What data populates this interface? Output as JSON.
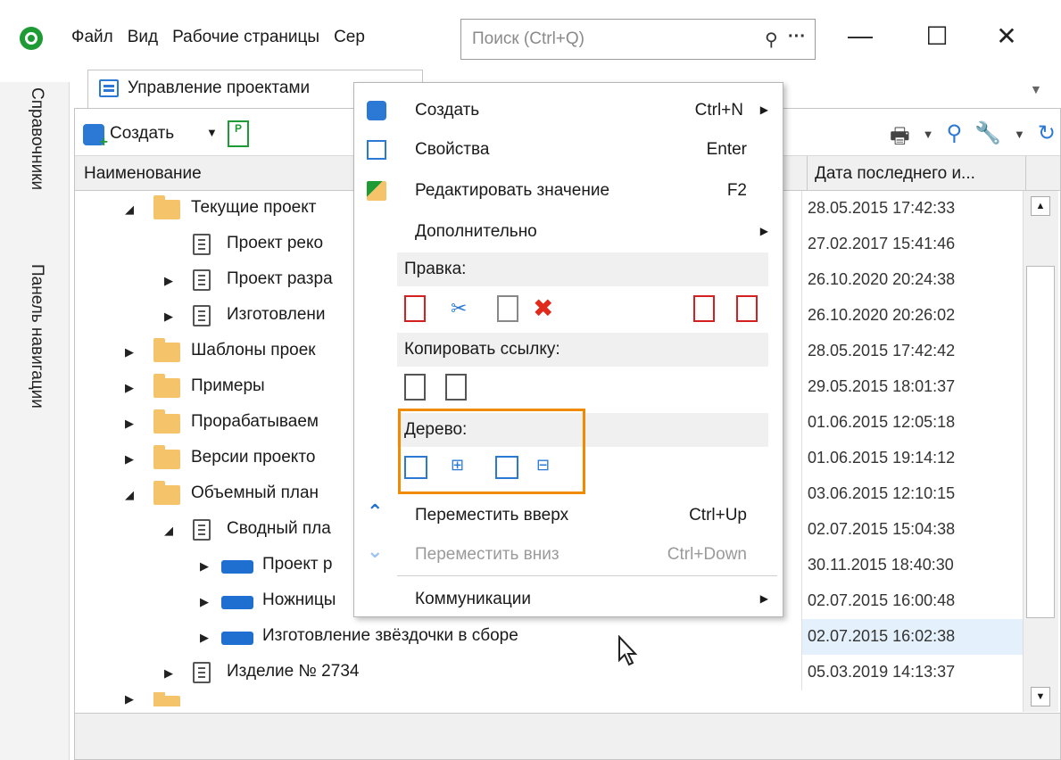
{
  "titlebar": {
    "menu": [
      "Файл",
      "Вид",
      "Рабочие страницы",
      "Сер"
    ],
    "search_placeholder": "Поиск (Ctrl+Q)",
    "search_dots": "···",
    "min": "—",
    "max": "☐",
    "close": "✕"
  },
  "side_panel": [
    "Справочники",
    "Панель навигации"
  ],
  "tab": {
    "label": "Управление проектами"
  },
  "toolbar": {
    "create": "Создать"
  },
  "grid": {
    "col_name": "Наименование",
    "col_date": "Дата последнего и...",
    "rows": [
      {
        "name": "Текущие проект",
        "date": "28.05.2015 17:42:33"
      },
      {
        "name": "Проект реко",
        "date": "27.02.2017 15:41:46"
      },
      {
        "name": "Проект разра",
        "date": "26.10.2020 20:24:38"
      },
      {
        "name": "Изготовлени",
        "date": "26.10.2020 20:26:02"
      },
      {
        "name": "Шаблоны проек",
        "date": "28.05.2015 17:42:42"
      },
      {
        "name": "Примеры",
        "date": "29.05.2015 18:01:37"
      },
      {
        "name": "Прорабатываем",
        "date": "01.06.2015 12:05:18"
      },
      {
        "name": "Версии проекто",
        "date": "01.06.2015 19:14:12"
      },
      {
        "name": "Объемный план",
        "date": "03.06.2015 12:10:15"
      },
      {
        "name": "Сводный пла",
        "date": "02.07.2015 15:04:38"
      },
      {
        "name": "Проект р",
        "date": "30.11.2015 18:40:30"
      },
      {
        "name": "Ножницы",
        "date": "02.07.2015 16:00:48"
      },
      {
        "name": "Изготовление звёздочки в сборе",
        "date": "02.07.2015 16:02:38"
      },
      {
        "name": "Изделие № 2734",
        "date": "05.03.2019 14:13:37"
      }
    ]
  },
  "context_menu": {
    "create": {
      "label": "Создать",
      "shortcut": "Ctrl+N"
    },
    "properties": {
      "label": "Свойства",
      "shortcut": "Enter"
    },
    "edit_value": {
      "label": "Редактировать значение",
      "shortcut": "F2"
    },
    "additional": {
      "label": "Дополнительно"
    },
    "section_edit": "Правка:",
    "section_copy_link": "Копировать ссылку:",
    "section_tree": "Дерево:",
    "move_up": {
      "label": "Переместить вверх",
      "shortcut": "Ctrl+Up"
    },
    "move_down": {
      "label": "Переместить вниз",
      "shortcut": "Ctrl+Down"
    },
    "communications": {
      "label": "Коммуникации"
    }
  },
  "colors": {
    "accent_blue": "#1f6fd0",
    "folder": "#f5c46a",
    "highlight_orange": "#f08a00",
    "logo_green": "#1e9b35"
  }
}
